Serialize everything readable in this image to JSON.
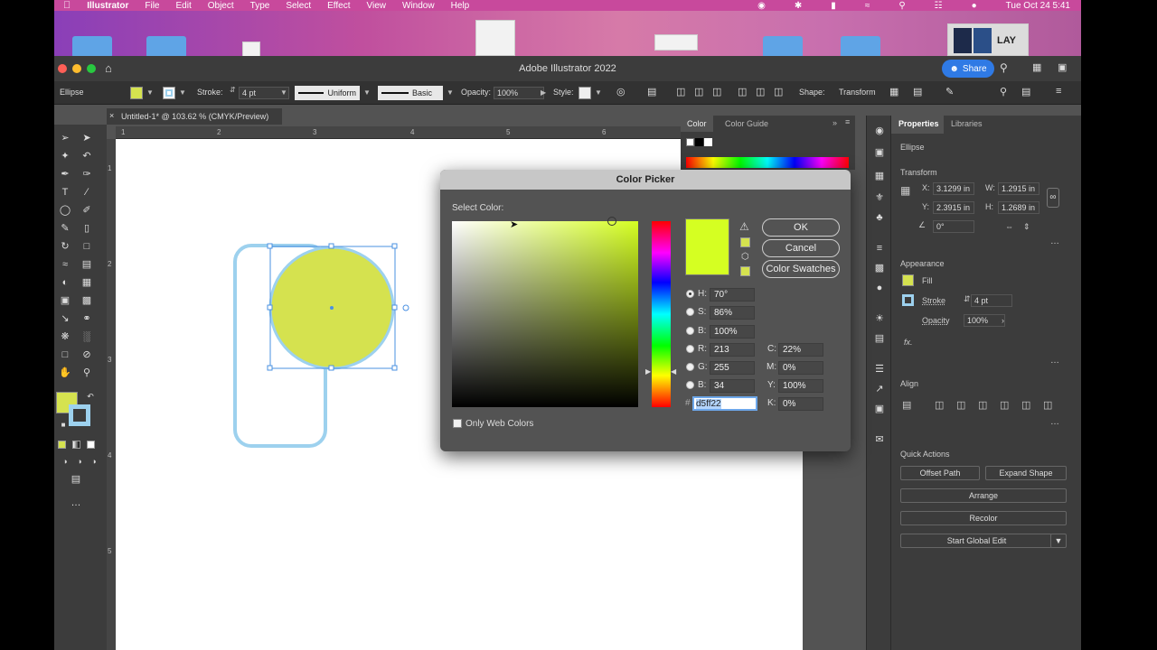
{
  "menubar": {
    "app": "Illustrator",
    "items": [
      "File",
      "Edit",
      "Object",
      "Type",
      "Select",
      "Effect",
      "View",
      "Window",
      "Help"
    ],
    "clock": "Tue Oct 24  5:41"
  },
  "desktop": {
    "thumb_label": "LAY"
  },
  "titlebar": {
    "title": "Adobe Illustrator 2022",
    "share_label": "Share"
  },
  "controlbar": {
    "object_type": "Ellipse",
    "fill_color": "#d5e24f",
    "stroke_color": "#9dd1ee",
    "stroke_label": "Stroke:",
    "stroke_weight": "4 pt",
    "stroke_profile": "Uniform",
    "brush": "Basic",
    "opacity_label": "Opacity:",
    "opacity_value": "100%",
    "style_label": "Style:",
    "shape_label": "Shape:",
    "transform_label": "Transform"
  },
  "document": {
    "tab_title": "Untitled-1* @ 103.62 % (CMYK/Preview)"
  },
  "rulers": {
    "h": [
      "1",
      "2",
      "3",
      "4",
      "5",
      "6"
    ],
    "v": [
      "1",
      "2",
      "3",
      "4",
      "5"
    ]
  },
  "colorpanel": {
    "tabs": [
      "Color",
      "Color Guide"
    ]
  },
  "properties": {
    "tabs": [
      "Properties",
      "Libraries"
    ],
    "object_type": "Ellipse",
    "transform_title": "Transform",
    "x_label": "X:",
    "x_value": "3.1299 in",
    "y_label": "Y:",
    "y_value": "2.3915 in",
    "w_label": "W:",
    "w_value": "1.2915 in",
    "h_label": "H:",
    "h_value": "1.2689 in",
    "angle_value": "0°",
    "appearance_title": "Appearance",
    "fill_label": "Fill",
    "stroke_label": "Stroke",
    "stroke_value": "4 pt",
    "opacity_label": "Opacity",
    "opacity_value": "100%",
    "fx_label": "fx.",
    "align_title": "Align",
    "quick_actions_title": "Quick Actions",
    "offset_path": "Offset Path",
    "expand_shape": "Expand Shape",
    "arrange": "Arrange",
    "recolor": "Recolor",
    "start_global_edit": "Start Global Edit"
  },
  "picker": {
    "title": "Color Picker",
    "select_color_label": "Select Color:",
    "ok": "OK",
    "cancel": "Cancel",
    "swatches": "Color Swatches",
    "preview_color": "#d5ff22",
    "H": "70°",
    "S": "86%",
    "B_hsb": "100%",
    "R": "213",
    "G": "255",
    "B_rgb": "34",
    "C": "22%",
    "M": "0%",
    "Y": "100%",
    "K": "0%",
    "hex": "d5ff22",
    "labels": {
      "h": "H:",
      "s": "S:",
      "b1": "B:",
      "r": "R:",
      "g": "G:",
      "b2": "B:",
      "c": "C:",
      "m": "M:",
      "y": "Y:",
      "k": "K:",
      "hash": "#"
    },
    "only_web_colors": "Only Web Colors"
  }
}
